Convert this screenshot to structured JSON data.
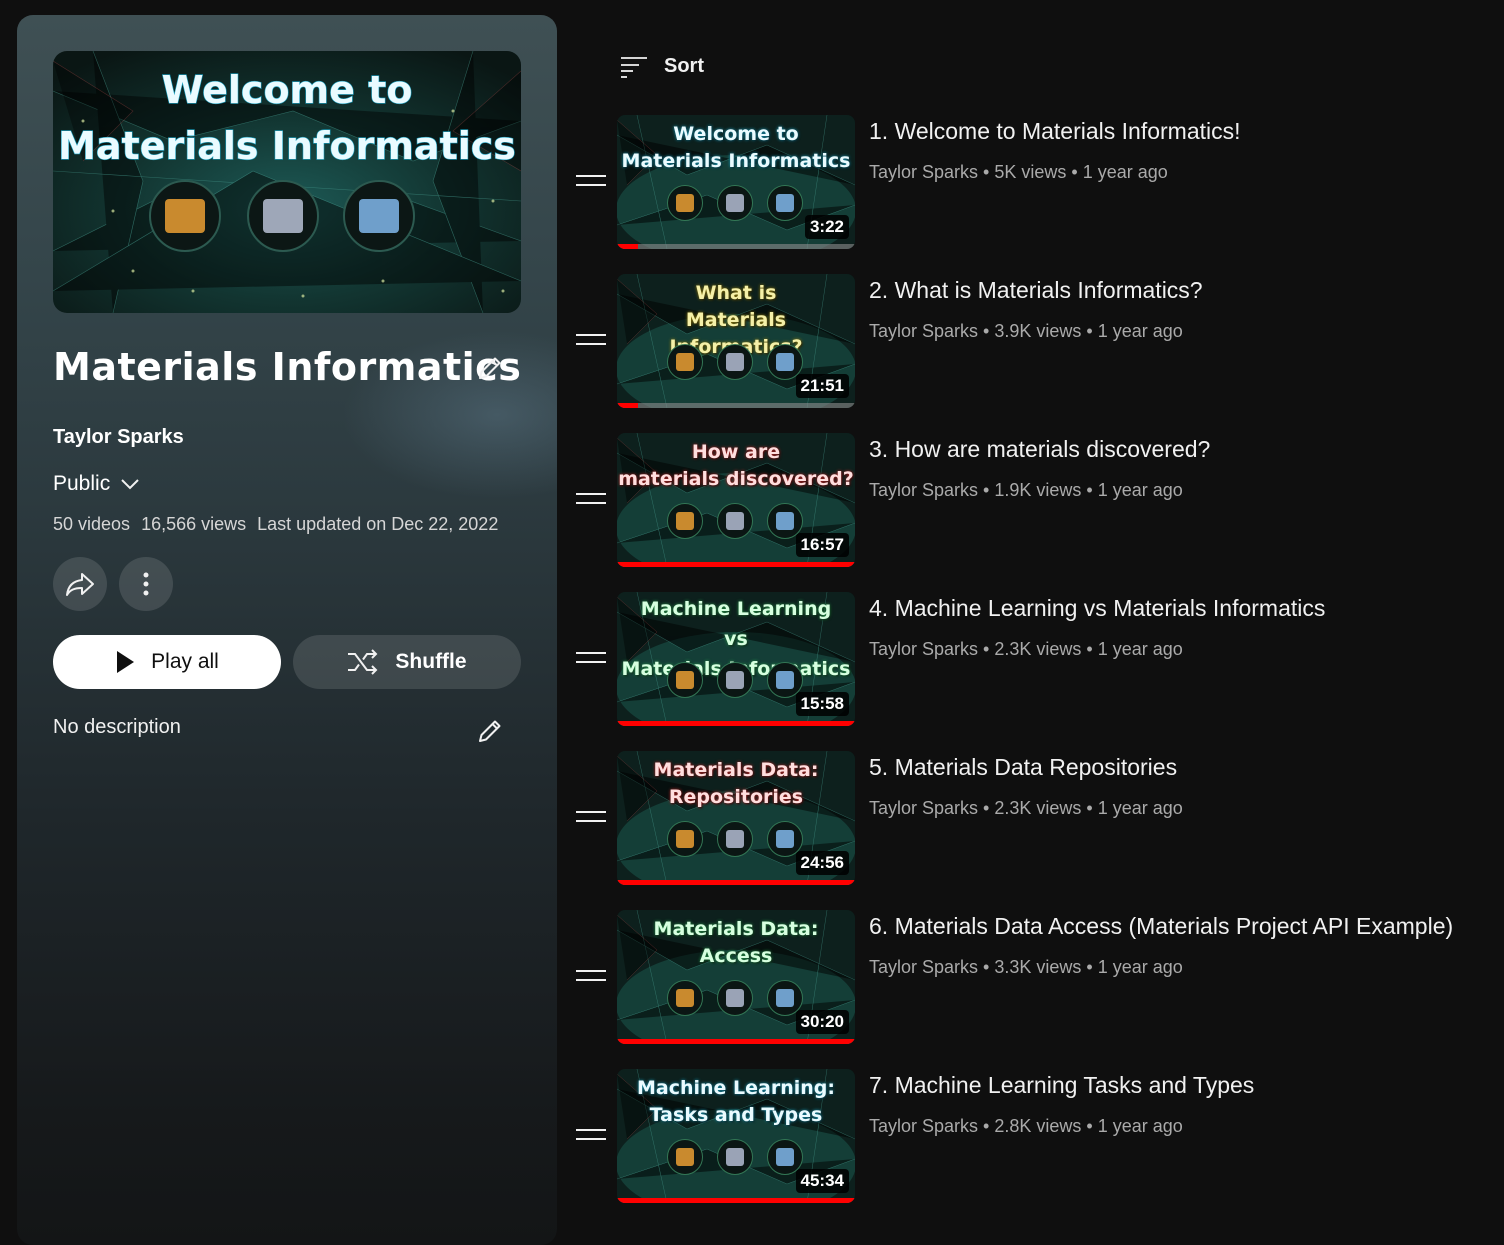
{
  "playlist": {
    "cover_title_line1": "Welcome to",
    "cover_title_line2": "Materials Informatics",
    "title": "Materials Informatics",
    "owner": "Taylor Sparks",
    "privacy": "Public",
    "video_count": "50 videos",
    "views": "16,566 views",
    "updated": "Last updated on Dec 22, 2022",
    "play_all_label": "Play all",
    "shuffle_label": "Shuffle",
    "description": "No description"
  },
  "sort": {
    "label": "Sort"
  },
  "videos": [
    {
      "thumb_text": "Welcome to\nMaterials Informatics",
      "title": "1. Welcome to Materials Informatics!",
      "channel": "Taylor Sparks",
      "views": "5K views",
      "age": "1 year ago",
      "duration": "3:22",
      "watched_fraction": 0.09
    },
    {
      "thumb_text": "What is\nMaterials Informatics?",
      "title": "2. What is Materials Informatics?",
      "channel": "Taylor Sparks",
      "views": "3.9K views",
      "age": "1 year ago",
      "duration": "21:51",
      "watched_fraction": 0.09
    },
    {
      "thumb_text": "How are\nmaterials discovered?",
      "title": "3. How are materials discovered?",
      "channel": "Taylor Sparks",
      "views": "1.9K views",
      "age": "1 year ago",
      "duration": "16:57",
      "watched_fraction": 1.0
    },
    {
      "thumb_text": "Machine Learning\nvs\nMaterials Informatics",
      "title": "4. Machine Learning vs Materials Informatics",
      "channel": "Taylor Sparks",
      "views": "2.3K views",
      "age": "1 year ago",
      "duration": "15:58",
      "watched_fraction": 1.0
    },
    {
      "thumb_text": "Materials Data:\nRepositories",
      "title": "5. Materials Data Repositories",
      "channel": "Taylor Sparks",
      "views": "2.3K views",
      "age": "1 year ago",
      "duration": "24:56",
      "watched_fraction": 1.0
    },
    {
      "thumb_text": "Materials Data:\nAccess",
      "title": "6. Materials Data Access (Materials Project API Example)",
      "channel": "Taylor Sparks",
      "views": "3.3K views",
      "age": "1 year ago",
      "duration": "30:20",
      "watched_fraction": 1.0
    },
    {
      "thumb_text": "Machine Learning:\nTasks and Types",
      "title": "7. Machine Learning Tasks and Types",
      "channel": "Taylor Sparks",
      "views": "2.8K views",
      "age": "1 year ago",
      "duration": "45:34",
      "watched_fraction": 1.0
    }
  ],
  "icons": {
    "edit": "pencil-icon",
    "privacy_dropdown": "chevron-down-icon",
    "share": "share-icon",
    "more": "more-vert-icon",
    "play": "play-icon",
    "shuffle": "shuffle-icon",
    "sort": "sort-icon",
    "drag": "drag-handle-icon"
  },
  "colors": {
    "background": "#0f0f0f",
    "progress": "#ff0000",
    "meta_text": "#aaaaaa"
  }
}
